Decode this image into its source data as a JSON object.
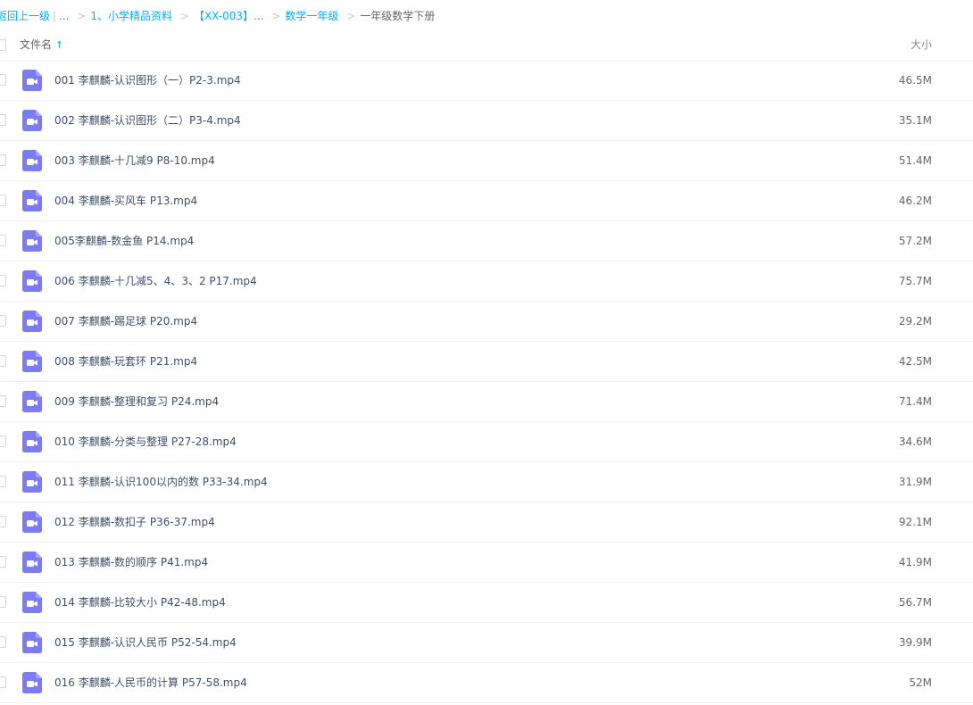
{
  "breadcrumb": {
    "back": "返回上一级",
    "ellipsis": "...",
    "items": [
      "1、小学精品资料",
      "【XX-003】...",
      "数学一年级"
    ],
    "current": "一年级数学下册",
    "separator": ">",
    "divider": "|"
  },
  "header": {
    "name_label": "文件名",
    "sort_icon": "arrow-up-icon",
    "size_label": "大小"
  },
  "colors": {
    "link": "#09aaff",
    "video_icon": "#7b7bf2"
  },
  "files": [
    {
      "name": "001 李麒麟-认识图形（一）P2-3.mp4",
      "size": "46.5M"
    },
    {
      "name": "002 李麒麟-认识图形（二）P3-4.mp4",
      "size": "35.1M"
    },
    {
      "name": "003 李麒麟-十几减9 P8-10.mp4",
      "size": "51.4M"
    },
    {
      "name": "004 李麒麟-买风车 P13.mp4",
      "size": "46.2M"
    },
    {
      "name": "005李麒麟-数金鱼 P14.mp4",
      "size": "57.2M"
    },
    {
      "name": "006 李麒麟-十几减5、4、3、2 P17.mp4",
      "size": "75.7M"
    },
    {
      "name": "007 李麒麟-踢足球 P20.mp4",
      "size": "29.2M"
    },
    {
      "name": "008 李麒麟-玩套环 P21.mp4",
      "size": "42.5M"
    },
    {
      "name": "009 李麒麟-整理和复习 P24.mp4",
      "size": "71.4M"
    },
    {
      "name": "010 李麒麟-分类与整理 P27-28.mp4",
      "size": "34.6M"
    },
    {
      "name": "011 李麒麟-认识100以内的数 P33-34.mp4",
      "size": "31.9M"
    },
    {
      "name": "012 李麒麟-数扣子 P36-37.mp4",
      "size": "92.1M"
    },
    {
      "name": "013 李麒麟-数的顺序 P41.mp4",
      "size": "41.9M"
    },
    {
      "name": "014 李麒麟-比较大小 P42-48.mp4",
      "size": "56.7M"
    },
    {
      "name": "015 李麒麟-认识人民币 P52-54.mp4",
      "size": "39.9M"
    },
    {
      "name": "016 李麒麟-人民币的计算 P57-58.mp4",
      "size": "52M"
    }
  ]
}
